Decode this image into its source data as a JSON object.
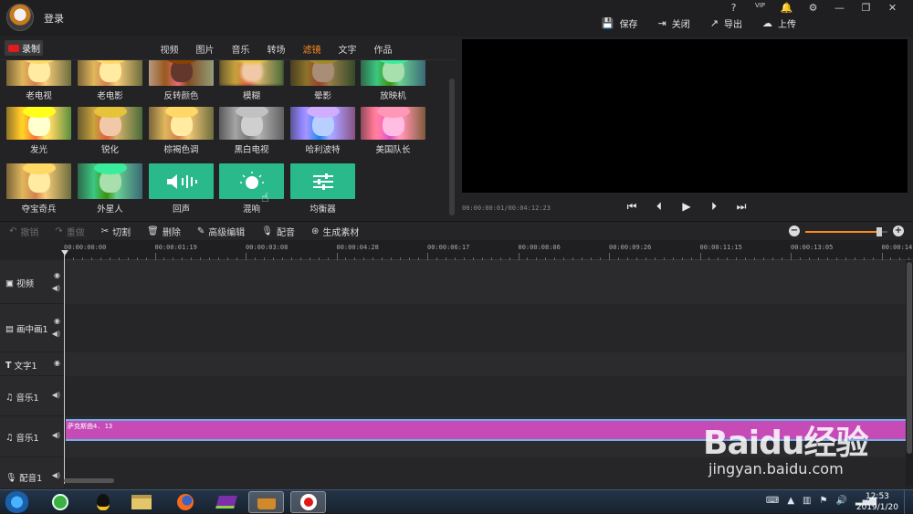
{
  "header": {
    "login": "登录",
    "top_icons": [
      "?",
      "VIP",
      "🔔",
      "⚙",
      "—",
      "❐",
      "✕"
    ],
    "actions": [
      {
        "icon": "save-icon",
        "label": "保存"
      },
      {
        "icon": "close-icon",
        "label": "关闭"
      },
      {
        "icon": "export-icon",
        "label": "导出"
      },
      {
        "icon": "upload-icon",
        "label": "上传"
      }
    ]
  },
  "media": {
    "record_label": "录制",
    "tabs": [
      "视频",
      "图片",
      "音乐",
      "转场",
      "滤镜",
      "文字",
      "作品"
    ],
    "active_tab": "滤镜",
    "row1": [
      "老电视",
      "老电影",
      "反转颜色",
      "模糊",
      "晕影",
      "放映机"
    ],
    "row2": [
      "发光",
      "锐化",
      "棕褐色调",
      "黑白电视",
      "哈利波特",
      "美国队长"
    ],
    "row3": [
      "夺宝奇兵",
      "外星人",
      "回声",
      "混响",
      "均衡器"
    ]
  },
  "preview": {
    "timecode": "00:00:00:01/00:04:12:23",
    "controls": [
      "skip-start",
      "step-back",
      "play",
      "step-forward",
      "skip-end"
    ]
  },
  "toolbar": {
    "undo": "撤销",
    "redo": "重做",
    "cut": "切割",
    "delete": "删除",
    "advanced": "高级编辑",
    "dub": "配音",
    "generate": "生成素材",
    "zoom_level": 0.9
  },
  "timeline": {
    "ruler": [
      "00:00:00:00",
      "00:00:01:19",
      "00:00:03:08",
      "00:00:04:28",
      "00:00:06:17",
      "00:00:08:06",
      "00:00:09:26",
      "00:00:11:15",
      "00:00:13:05",
      "00:00:14:"
    ],
    "tracks": [
      "视频",
      "画中画1",
      "文字1",
      "音乐1",
      "音乐1",
      "配音1"
    ],
    "clip_label": "萨克斯曲4. 13"
  },
  "taskbar": {
    "time": "12:53",
    "date": "2019/1/20"
  },
  "watermark": {
    "brand": "Baidu经验",
    "url": "jingyan.baidu.com"
  }
}
